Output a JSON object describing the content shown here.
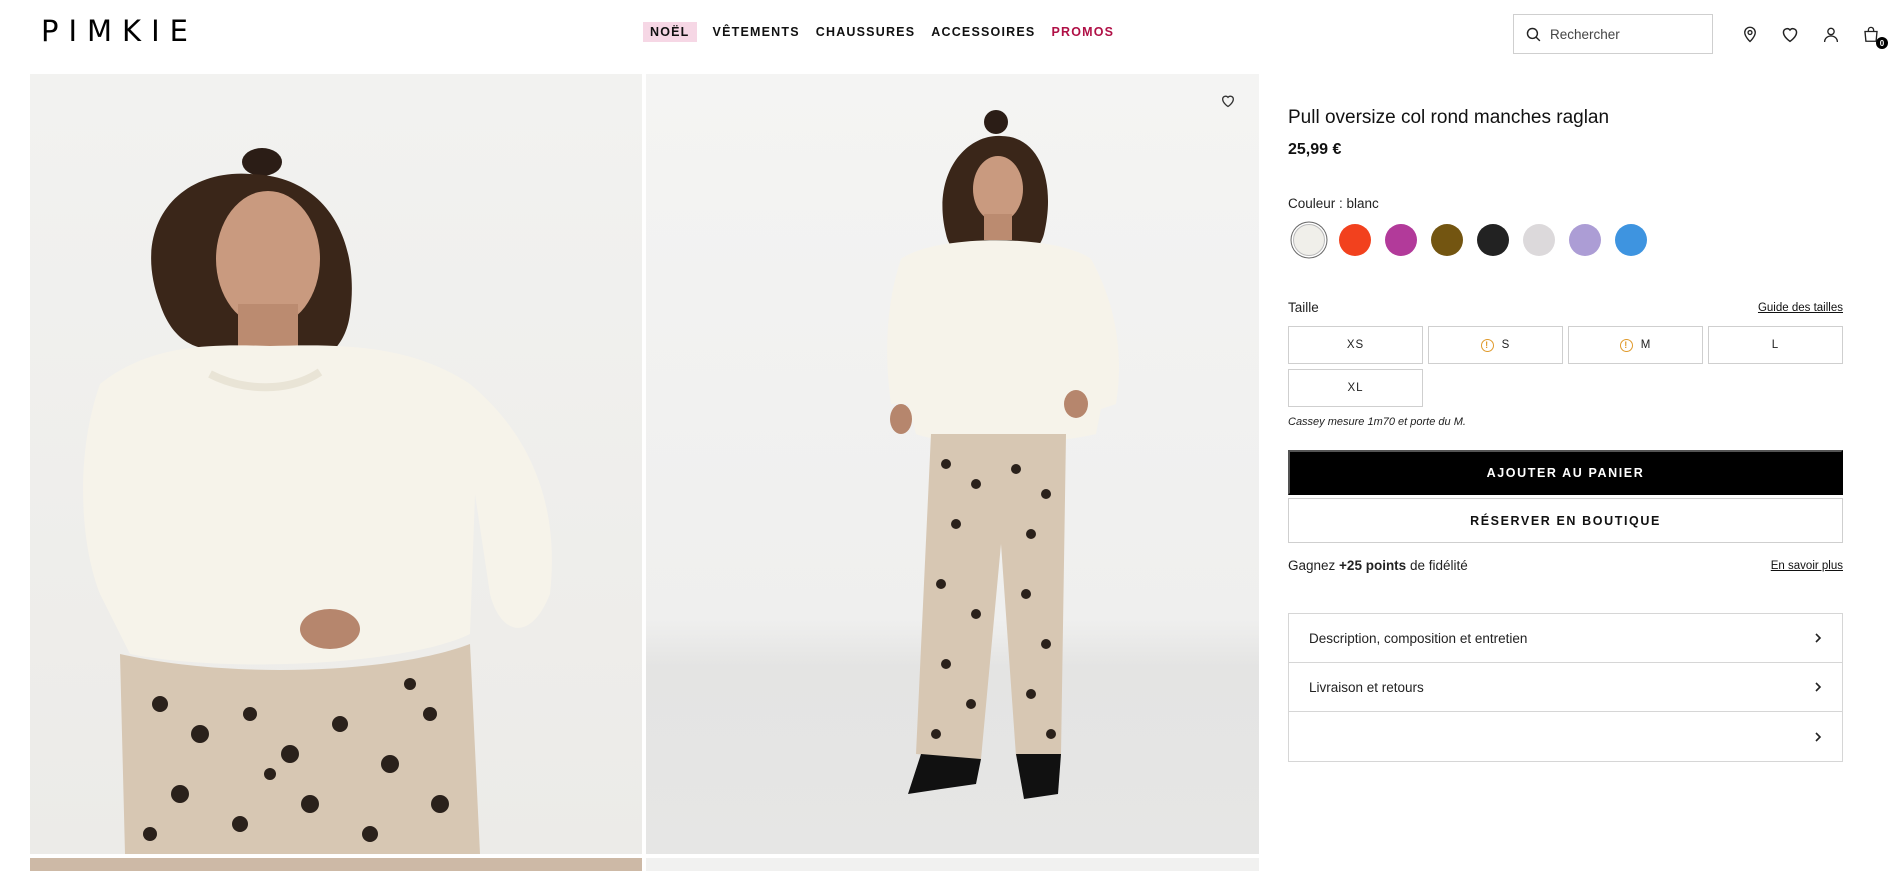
{
  "header": {
    "logo": "PIMKIE",
    "nav": [
      {
        "label": "NOËL",
        "style": "noel"
      },
      {
        "label": "VÊTEMENTS",
        "style": ""
      },
      {
        "label": "CHAUSSURES",
        "style": ""
      },
      {
        "label": "ACCESSOIRES",
        "style": ""
      },
      {
        "label": "PROMOS",
        "style": "promos"
      }
    ],
    "search_placeholder": "Rechercher",
    "cart_count": "0",
    "icons": [
      "search-icon",
      "store-locator-icon",
      "wishlist-icon",
      "account-icon",
      "cart-icon"
    ]
  },
  "gallery": {
    "images": [
      "product-photo-closeup",
      "product-photo-full-body"
    ],
    "wishlist_icon": "heart-icon"
  },
  "product": {
    "title": "Pull oversize col rond manches raglan",
    "price": "25,99 €",
    "color_label": "Couleur : blanc",
    "colors": [
      {
        "name": "blanc",
        "hex": "#f0efea",
        "selected": true
      },
      {
        "name": "orange",
        "hex": "#f2411e",
        "selected": false
      },
      {
        "name": "fuchsia",
        "hex": "#b23a9a",
        "selected": false
      },
      {
        "name": "camel",
        "hex": "#735511",
        "selected": false
      },
      {
        "name": "noir",
        "hex": "#222222",
        "selected": false
      },
      {
        "name": "gris clair",
        "hex": "#dcd9db",
        "selected": false
      },
      {
        "name": "lilas",
        "hex": "#ac9dd5",
        "selected": false
      },
      {
        "name": "bleu",
        "hex": "#3e94e0",
        "selected": false
      }
    ],
    "size_label": "Taille",
    "size_guide": "Guide des tailles",
    "sizes": [
      {
        "label": "XS",
        "low_stock": false
      },
      {
        "label": "S",
        "low_stock": true
      },
      {
        "label": "M",
        "low_stock": true
      },
      {
        "label": "L",
        "low_stock": false
      },
      {
        "label": "XL",
        "low_stock": false
      }
    ],
    "model_note": "Cassey mesure 1m70 et porte du M.",
    "add_to_cart": "AJOUTER AU PANIER",
    "reserve": "RÉSERVER EN BOUTIQUE",
    "loyalty": {
      "prefix": "Gagnez ",
      "points": "+25 points",
      "suffix": " de fidélité",
      "link": "En savoir plus"
    },
    "accordion": [
      {
        "label": "Description, composition et entretien"
      },
      {
        "label": "Livraison et retours"
      },
      {
        "label": ""
      }
    ]
  },
  "colors": {
    "accent_noel_bg": "#f6d7e5",
    "promo": "#b01046",
    "warning": "#e09a2c",
    "primary_button": "#000000"
  }
}
